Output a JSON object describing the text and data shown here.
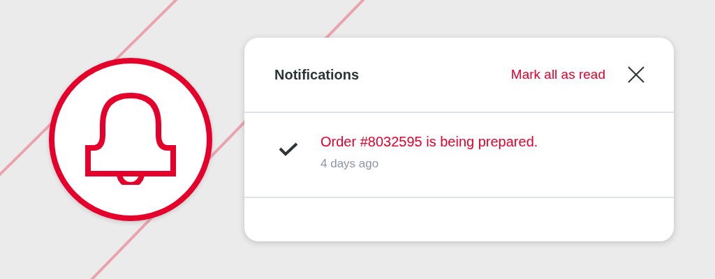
{
  "panel": {
    "title": "Notifications",
    "action": "Mark all as read"
  },
  "notifications": [
    {
      "text": "Order #8032595 is being prepared.",
      "time": "4 days ago",
      "read": true
    }
  ]
}
